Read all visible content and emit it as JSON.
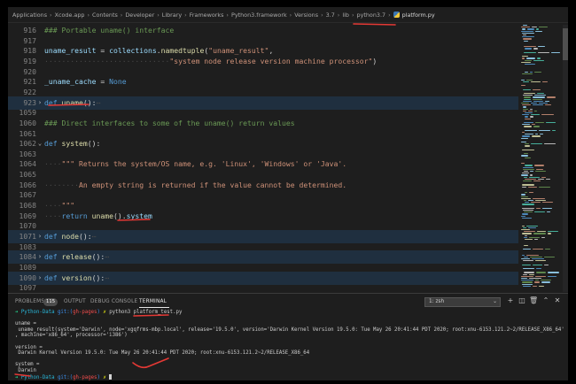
{
  "breadcrumb": [
    "Applications",
    "Xcode.app",
    "Contents",
    "Developer",
    "Library",
    "Frameworks",
    "Python3.framework",
    "Versions",
    "3.7",
    "lib",
    "python3.7"
  ],
  "breadcrumb_file": "platform.py",
  "editor": {
    "lines": [
      {
        "num": "916",
        "tokens": [
          {
            "c": "cm",
            "t": "### Portable uname() interface"
          }
        ]
      },
      {
        "num": "917",
        "tokens": []
      },
      {
        "num": "918",
        "tokens": [
          {
            "c": "vr",
            "t": "uname_result"
          },
          {
            "c": "",
            "t": " = "
          },
          {
            "c": "vr",
            "t": "collections"
          },
          {
            "c": "",
            "t": "."
          },
          {
            "c": "fn",
            "t": "namedtuple"
          },
          {
            "c": "",
            "t": "("
          },
          {
            "c": "st",
            "t": "\"uname_result\""
          },
          {
            "c": "",
            "t": ","
          }
        ]
      },
      {
        "num": "919",
        "tokens": [
          {
            "c": "dotted",
            "t": "·····························"
          },
          {
            "c": "st",
            "t": "\"system node release version machine processor\""
          },
          {
            "c": "",
            "t": ")"
          }
        ]
      },
      {
        "num": "920",
        "tokens": []
      },
      {
        "num": "921",
        "tokens": [
          {
            "c": "vr",
            "t": "_uname_cache"
          },
          {
            "c": "",
            "t": " = "
          },
          {
            "c": "kw",
            "t": "None"
          }
        ]
      },
      {
        "num": "922",
        "tokens": []
      },
      {
        "num": "923",
        "fold": "›",
        "hl": true,
        "tokens": [
          {
            "c": "kw",
            "t": "def"
          },
          {
            "c": "",
            "t": " "
          },
          {
            "c": "fn",
            "t": "uname"
          },
          {
            "c": "",
            "t": "():"
          },
          {
            "c": "dotted",
            "t": "⋯"
          }
        ]
      },
      {
        "num": "1059",
        "tokens": []
      },
      {
        "num": "1060",
        "tokens": [
          {
            "c": "cm",
            "t": "### Direct interfaces to some of the uname() return values"
          }
        ]
      },
      {
        "num": "1061",
        "tokens": []
      },
      {
        "num": "1062",
        "fold": "⌄",
        "tokens": [
          {
            "c": "kw",
            "t": "def"
          },
          {
            "c": "",
            "t": " "
          },
          {
            "c": "fn",
            "t": "system"
          },
          {
            "c": "",
            "t": "():"
          }
        ]
      },
      {
        "num": "1063",
        "tokens": []
      },
      {
        "num": "1064",
        "tokens": [
          {
            "c": "dotted",
            "t": "····"
          },
          {
            "c": "st",
            "t": "\"\"\" Returns the system/OS name, e.g. 'Linux', 'Windows' or 'Java'."
          }
        ]
      },
      {
        "num": "1065",
        "tokens": []
      },
      {
        "num": "1066",
        "tokens": [
          {
            "c": "dotted",
            "t": "········"
          },
          {
            "c": "st",
            "t": "An empty string is returned if the value cannot be determined."
          }
        ]
      },
      {
        "num": "1067",
        "tokens": []
      },
      {
        "num": "1068",
        "tokens": [
          {
            "c": "dotted",
            "t": "····"
          },
          {
            "c": "st",
            "t": "\"\"\""
          }
        ]
      },
      {
        "num": "1069",
        "tokens": [
          {
            "c": "dotted",
            "t": "····"
          },
          {
            "c": "kw",
            "t": "return"
          },
          {
            "c": "",
            "t": " "
          },
          {
            "c": "fn",
            "t": "uname"
          },
          {
            "c": "",
            "t": "()."
          },
          {
            "c": "vr",
            "t": "system"
          }
        ]
      },
      {
        "num": "1070",
        "tokens": []
      },
      {
        "num": "1071",
        "fold": "›",
        "hl": true,
        "tokens": [
          {
            "c": "kw",
            "t": "def"
          },
          {
            "c": "",
            "t": " "
          },
          {
            "c": "fn",
            "t": "node"
          },
          {
            "c": "",
            "t": "():"
          },
          {
            "c": "dotted",
            "t": "⋯"
          }
        ]
      },
      {
        "num": "1083",
        "tokens": []
      },
      {
        "num": "1084",
        "fold": "›",
        "hl": true,
        "tokens": [
          {
            "c": "kw",
            "t": "def"
          },
          {
            "c": "",
            "t": " "
          },
          {
            "c": "fn",
            "t": "release"
          },
          {
            "c": "",
            "t": "():"
          },
          {
            "c": "dotted",
            "t": "⋯"
          }
        ]
      },
      {
        "num": "1089",
        "tokens": []
      },
      {
        "num": "1090",
        "fold": "›",
        "hl": true,
        "tokens": [
          {
            "c": "kw",
            "t": "def"
          },
          {
            "c": "",
            "t": " "
          },
          {
            "c": "fn",
            "t": "version"
          },
          {
            "c": "",
            "t": "():"
          },
          {
            "c": "dotted",
            "t": "⋯"
          }
        ]
      },
      {
        "num": "1097",
        "tokens": []
      }
    ]
  },
  "panel": {
    "tabs": [
      {
        "label": "PROBLEMS",
        "badge": "115"
      },
      {
        "label": "OUTPUT"
      },
      {
        "label": "DEBUG CONSOLE"
      },
      {
        "label": "TERMINAL",
        "active": true
      }
    ],
    "shell_select": "1: zsh",
    "icons": [
      "plus-icon",
      "split-icon",
      "trash-icon",
      "chevron-up-icon",
      "close-icon"
    ]
  },
  "terminal": {
    "lines": [
      [
        {
          "c": "arrow",
          "t": "➜ "
        },
        {
          "c": "cyan",
          "t": "Python-Data "
        },
        {
          "c": "blue",
          "t": "git:("
        },
        {
          "c": "red",
          "t": "gh-pages"
        },
        {
          "c": "blue",
          "t": ")"
        },
        {
          "c": "yellow",
          "t": " ✗ "
        },
        {
          "c": "",
          "t": "python3 platform_test.py"
        }
      ],
      [],
      [
        {
          "c": "",
          "t": "uname ="
        }
      ],
      [
        {
          "c": "",
          "t": " uname_result(system='Darwin', node='xgqfrms-mbp.local', release='19.5.0', version='Darwin Kernel Version 19.5.0: Tue May 26 20:41:44 PDT 2020; root:xnu-6153.121.2~2/RELEASE_X86_64'"
        }
      ],
      [
        {
          "c": "",
          "t": ", machine='x86_64', processor='i386')"
        }
      ],
      [],
      [
        {
          "c": "",
          "t": "version ="
        }
      ],
      [
        {
          "c": "",
          "t": " Darwin Kernel Version 19.5.0: Tue May 26 20:41:44 PDT 2020; root:xnu-6153.121.2~2/RELEASE_X86_64"
        }
      ],
      [],
      [
        {
          "c": "",
          "t": "system ="
        }
      ],
      [
        {
          "c": "",
          "t": " Darwin"
        }
      ],
      [
        {
          "c": "arrow",
          "t": "➜ "
        },
        {
          "c": "cyan",
          "t": "Python-Data "
        },
        {
          "c": "blue",
          "t": "git:("
        },
        {
          "c": "red",
          "t": "gh-pages"
        },
        {
          "c": "blue",
          "t": ")"
        },
        {
          "c": "yellow",
          "t": " ✗ "
        }
      ]
    ]
  },
  "colors": {
    "annotation": "#e53935",
    "editor_bg": "#1e1e1e",
    "highlight_line": "#1f2f3f"
  }
}
